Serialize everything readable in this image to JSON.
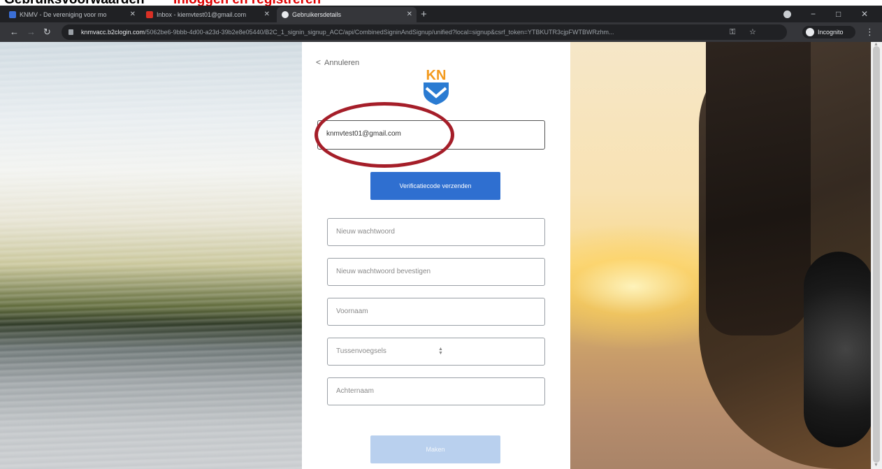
{
  "caption": {
    "part1": "Gebruiksvoorwaarden",
    "part2": "Inloggen en registreren",
    "colors": {
      "part1": "#000000",
      "part2": "#e00000"
    }
  },
  "browser": {
    "tabs": [
      {
        "title": "KNMV - De vereniging voor mo",
        "favicon_color": "#3b6fd6"
      },
      {
        "title": "Inbox - kiemvtest01@gmail.com",
        "favicon_color": "#d93025"
      },
      {
        "title": "Gebruikersdetails",
        "favicon_color": "#e8eaed"
      }
    ],
    "url_host": "knmvacc.b2clogin.com",
    "url_path": "/5062be6-9bbb-4d00-a23d-39b2e8e05440/B2C_1_signin_signup_ACC/api/CombinedSigninAndSignup/unified?local=signup&csrf_token=YTBKUTR3cjpFWTBWRzhm...",
    "incognito_label": "Incognito"
  },
  "form": {
    "cancel_label": "Annuleren",
    "email_value": "knmvtest01@gmail.com",
    "verify_button": "Verificatiecode verzenden",
    "new_password_placeholder": "Nieuw wachtwoord",
    "confirm_password_placeholder": "Nieuw wachtwoord bevestigen",
    "first_name_placeholder": "Voornaam",
    "infix_placeholder": "Tussenvoegsels",
    "last_name_placeholder": "Achternaam",
    "submit_button": "Maken"
  },
  "logo": {
    "letters": "KN",
    "colors": {
      "orange": "#f39a1e",
      "blue": "#2a7bd2"
    }
  },
  "annotation": {
    "ring_color": "#a51e29"
  }
}
